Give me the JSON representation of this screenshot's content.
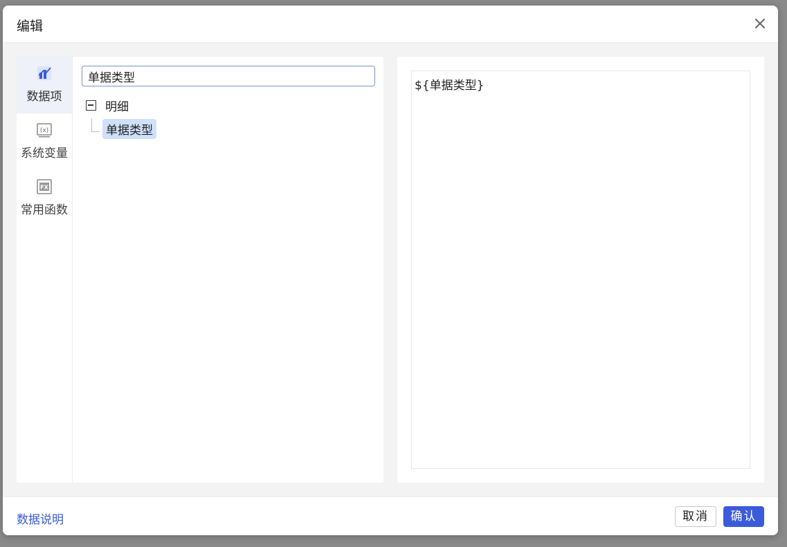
{
  "dialog": {
    "title": "编辑",
    "close_icon": "close-icon"
  },
  "side_nav": {
    "items": [
      {
        "label": "数据项",
        "icon": "data-item-icon",
        "active": true
      },
      {
        "label": "系统变量",
        "icon": "variable-x-icon",
        "active": false
      },
      {
        "label": "常用函数",
        "icon": "function-fx-icon",
        "active": false
      }
    ]
  },
  "search": {
    "value": "单据类型"
  },
  "tree": {
    "root_label": "明细",
    "expanded": true,
    "children": [
      {
        "label": "单据类型",
        "selected": true
      }
    ]
  },
  "editor": {
    "content": "${单据类型}"
  },
  "footer": {
    "help_link": "数据说明",
    "cancel_label": "取消",
    "confirm_label": "确认"
  },
  "colors": {
    "accent": "#3b5bdb",
    "link": "#3b5bd6",
    "selected_bg": "#cfe0fb",
    "active_nav_bg": "#eef1f9"
  }
}
